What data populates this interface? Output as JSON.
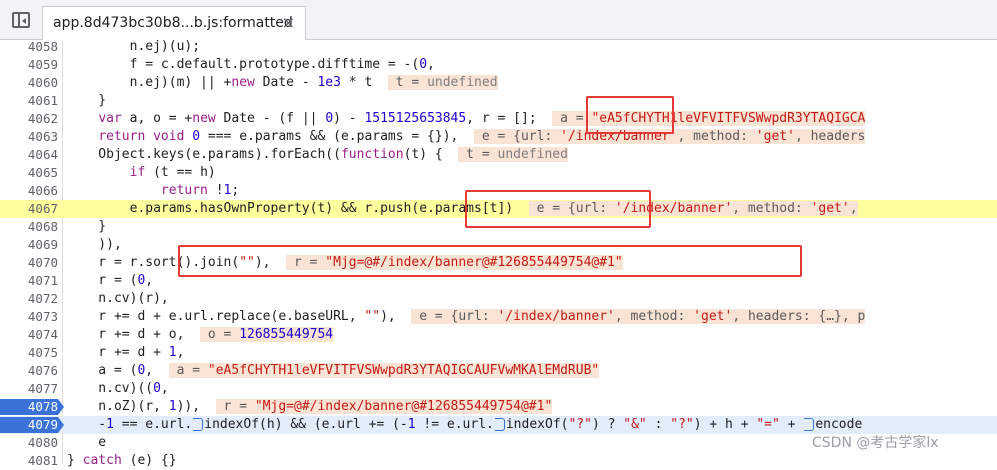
{
  "tab": {
    "title": "app.8d473bc30b8...b.js:formatted",
    "close": "×"
  },
  "watermark": "CSDN @考古学家lx",
  "lines": [
    {
      "n": "4058",
      "code": "        n.ej)(u);"
    },
    {
      "n": "4059",
      "code": "        f = c.default.prototype.difftime = -(0,"
    },
    {
      "n": "4060",
      "code": "        n.ej)(m) || +new Date - 1e3 * t  ",
      "inline": "t = undefined"
    },
    {
      "n": "4061",
      "code": "    }"
    },
    {
      "n": "4062",
      "code": "    var a, o = +new Date - (f || 0) - 1515125653845, r = [];  ",
      "inline": "a = \"eA5fCHYTH1leVFVITFVSWwpdR3YTAQIGCA"
    },
    {
      "n": "4063",
      "code": "    return void 0 === e.params && (e.params = {}),  ",
      "inline": "e = {url: '/index/banner', method: 'get', headers"
    },
    {
      "n": "4064",
      "code": "    Object.keys(e.params).forEach((function(t) {  ",
      "inline": "t = undefined"
    },
    {
      "n": "4065",
      "code": "        if (t == h)"
    },
    {
      "n": "4066",
      "code": "            return !1;"
    },
    {
      "n": "4067",
      "code": "        e.params.hasOwnProperty(t) && r.push(e.params[t])  ",
      "inline": "e = {url: '/index/banner', method: 'get',"
    },
    {
      "n": "4068",
      "code": "    }"
    },
    {
      "n": "4069",
      "code": "    )),"
    },
    {
      "n": "4070",
      "code": "    r = r.sort().join(\"\"),  ",
      "inline": "r = \"Mjg=@#/index/banner@#126855449754@#1\""
    },
    {
      "n": "4071",
      "code": "    r = (0,"
    },
    {
      "n": "4072",
      "code": "    n.cv)(r),"
    },
    {
      "n": "4073",
      "code": "    r += d + e.url.replace(e.baseURL, \"\"),  ",
      "inline": "e = {url: '/index/banner', method: 'get', headers: {…}, p"
    },
    {
      "n": "4074",
      "code": "    r += d + o,  ",
      "inline": "o = 126855449754"
    },
    {
      "n": "4075",
      "code": "    r += d + 1,"
    },
    {
      "n": "4076",
      "code": "    a = (0,  ",
      "inline": "a = \"eA5fCHYTH1leVFVITFVSWwpdR3YTAQIGCAUFVwMKAlEMdRUB\""
    },
    {
      "n": "4077",
      "code": "    n.cv)((0,"
    },
    {
      "n": "4078",
      "code": "    n.oZ)(r, 1)),  ",
      "inline": "r = \"Mjg=@#/index/banner@#126855449754@#1\""
    },
    {
      "n": "4079",
      "code": "    -1 == e.url.▷indexOf(h) && (e.url += (-1 != e.url.▷indexOf(\"?\") ? \"&\" : \"?\") + h + \"=\" + ▷encode"
    },
    {
      "n": "4080",
      "code": "    e"
    },
    {
      "n": "4081",
      "code": "} catch (e) {}"
    }
  ]
}
